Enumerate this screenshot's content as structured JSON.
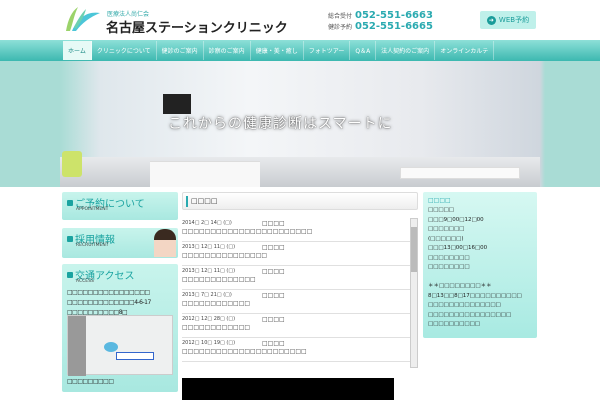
{
  "header": {
    "org": "医療法人尚仁会",
    "clinic_name": "名古屋ステーションクリニック",
    "tel1_label": "総合受付",
    "tel1": "052-551-6663",
    "tel2_label": "健診予約",
    "tel2": "052-551-6665",
    "web_button": "WEB予約"
  },
  "nav": [
    "ホーム",
    "クリニックについて",
    "健診のご案内",
    "診察のご案内",
    "健康・美・癒し",
    "フォトツアー",
    "Q＆A",
    "法人契約のご案内",
    "オンラインカルテ"
  ],
  "hero": {
    "catch": "これからの健康診断はスマートに"
  },
  "left": {
    "appointment": {
      "title": "ご予約について",
      "sub": "APPOINTMENT"
    },
    "recruit": {
      "title": "採用情報",
      "sub": "RECRUITMENT"
    },
    "access": {
      "title": "交通アクセス",
      "sub": "ACCESS",
      "line1": "□□□□□□□□□□□□□□□□",
      "line2": "□□□□□□□□□□□□□4-6-17",
      "line3": "□□□□□□□□□□8□",
      "footer": "□□□□□□□□□"
    }
  },
  "news": {
    "title": "□□□□",
    "items": [
      {
        "date": "2014□ 2□ 14□ (□)",
        "cat": "□□□□",
        "text": "□□□□□□□□□□□□□□□□□□□□□□□"
      },
      {
        "date": "2013□ 12□ 11□ (□)",
        "cat": "□□□□",
        "text": "□□□□□□□□□□□□□□□"
      },
      {
        "date": "2013□ 12□ 11□ (□)",
        "cat": "□□□□",
        "text": "□□□□□□□□□□□□□"
      },
      {
        "date": "2013□ 7□ 21□ (□)",
        "cat": "□□□□",
        "text": "□□□□□□□□□□□□"
      },
      {
        "date": "2012□ 12□ 28□ (□)",
        "cat": "□□□□",
        "text": "□□□□□□□□□□□□"
      },
      {
        "date": "2012□ 10□ 19□ (□)",
        "cat": "□□□□",
        "text": "□□□□□□□□□□□□□□□□□□□□□□"
      }
    ]
  },
  "hours": {
    "title": "□□□□",
    "lines": [
      "□□□□□",
      "□□□9□00□12□00",
      "□□□□□□□",
      "(□□□□□□)",
      "□□□13□00□16□00",
      "□□□□□□□□",
      "□□□□□□□□",
      "",
      "＊＊□□□□□□□□＊＊",
      "8□13□□8□17□□□□□□□□□□",
      "□□□□□□□□□□□□□□",
      "□□□□□□□□□□□□□□□□",
      "□□□□□□□□□□"
    ]
  }
}
